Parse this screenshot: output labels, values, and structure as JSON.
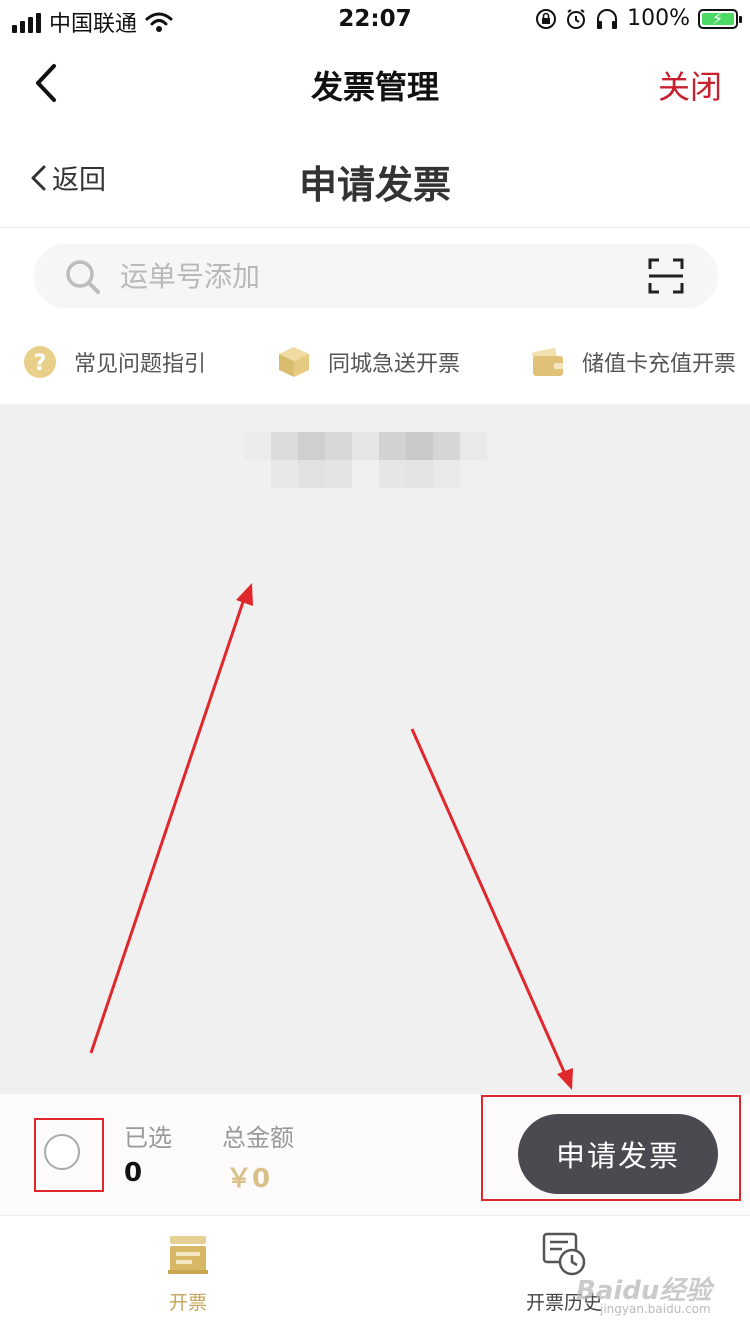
{
  "status_bar": {
    "carrier": "中国联通",
    "time": "22:07",
    "battery": "100%"
  },
  "nav": {
    "title": "发票管理",
    "close_label": "关闭"
  },
  "sub_header": {
    "back_label": "返回",
    "title": "申请发票"
  },
  "search": {
    "placeholder": "运单号添加",
    "scan_icon": "scan-icon"
  },
  "quick_links": [
    {
      "label": "常见问题指引",
      "icon": "question-icon"
    },
    {
      "label": "同城急送开票",
      "icon": "package-icon"
    },
    {
      "label": "储值卡充值开票",
      "icon": "wallet-icon"
    }
  ],
  "action_bar": {
    "selected_label": "已选",
    "selected_count": "0",
    "total_label": "总金额",
    "total_value": "￥0",
    "apply_label": "申请发票"
  },
  "tabs": [
    {
      "label": "开票",
      "icon": "invoice-icon",
      "active": true
    },
    {
      "label": "开票历史",
      "icon": "history-icon",
      "active": false
    }
  ],
  "watermark": {
    "brand": "Baidu经验",
    "url": "jingyan.baidu.com"
  },
  "colors": {
    "accent_red": "#c8202e",
    "gold": "#c8a45a",
    "button_dark": "#4a4a50",
    "content_bg": "#f1f0f0"
  }
}
